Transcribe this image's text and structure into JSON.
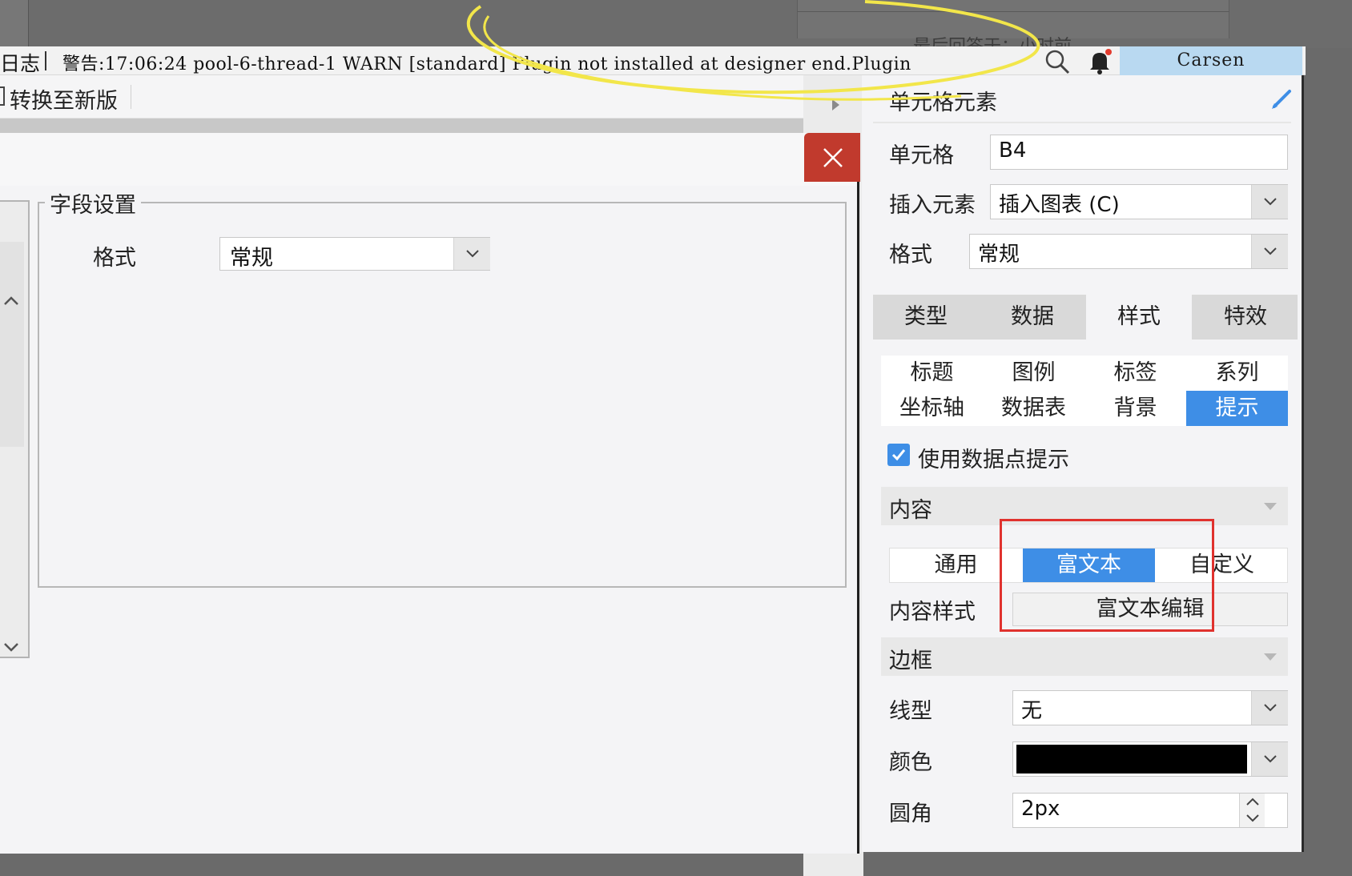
{
  "topbar": {
    "ghost_text": "最后回答于：小时前"
  },
  "logbar": {
    "label": "日志",
    "message": "警告:17:06:24 pool-6-thread-1 WARN [standard] Plugin not installed at designer end.Plugin",
    "user": "Carsen"
  },
  "toolbar": {
    "convert_label": "转换至新版"
  },
  "dialog": {
    "fieldset_title": "字段设置",
    "format_label": "格式",
    "format_value": "常规"
  },
  "panel": {
    "title": "单元格元素",
    "cell_label": "单元格",
    "cell_value": "B4",
    "insert_label": "插入元素",
    "insert_value": "插入图表 (C)",
    "format_label": "格式",
    "format_value": "常规",
    "main_tabs": [
      {
        "label": "类型"
      },
      {
        "label": "数据"
      },
      {
        "label": "样式"
      },
      {
        "label": "特效"
      }
    ],
    "sub_tabs": [
      {
        "label": "标题"
      },
      {
        "label": "图例"
      },
      {
        "label": "标签"
      },
      {
        "label": "系列"
      },
      {
        "label": "坐标轴"
      },
      {
        "label": "数据表"
      },
      {
        "label": "背景"
      },
      {
        "label": "提示"
      }
    ],
    "use_tooltip_label": "使用数据点提示",
    "content_section": "内容",
    "content_modes": [
      {
        "label": "通用"
      },
      {
        "label": "富文本"
      },
      {
        "label": "自定义"
      }
    ],
    "content_style_label": "内容样式",
    "rich_text_edit": "富文本编辑",
    "border_section": "边框",
    "line_type_label": "线型",
    "line_type_value": "无",
    "color_label": "颜色",
    "radius_label": "圆角",
    "radius_value": "2px"
  },
  "colors": {
    "accent": "#3e8ee6",
    "close": "#c13a2d",
    "highlight": "#e0322e",
    "annotation": "#f2e64a"
  }
}
